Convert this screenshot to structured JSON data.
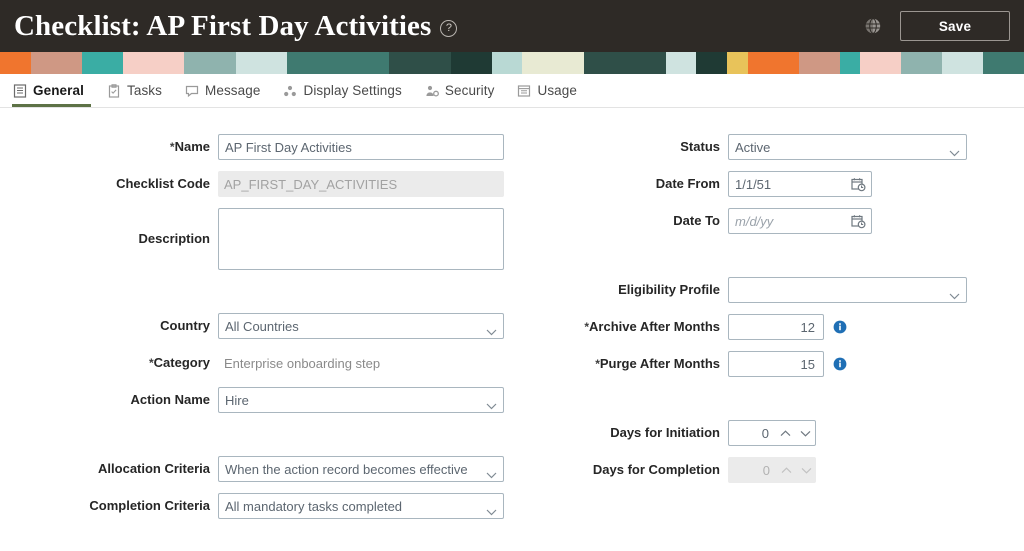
{
  "header": {
    "title": "Checklist: AP First Day Activities",
    "help_icon": "help-circle-icon",
    "globe_icon": "globe-icon",
    "save_label": "Save",
    "background_color": "#2e2a26"
  },
  "tabs": [
    {
      "label": "General",
      "icon": "list-lines-icon",
      "active": true
    },
    {
      "label": "Tasks",
      "icon": "clipboard-icon",
      "active": false
    },
    {
      "label": "Message",
      "icon": "speech-bubble-icon",
      "active": false
    },
    {
      "label": "Display Settings",
      "icon": "dots-group-icon",
      "active": false
    },
    {
      "label": "Security",
      "icon": "person-gear-icon",
      "active": false
    },
    {
      "label": "Usage",
      "icon": "window-list-icon",
      "active": false
    }
  ],
  "active_tab_color": "#5d7246",
  "form": {
    "left": {
      "name": {
        "label": "Name",
        "required": true,
        "value": "AP First Day Activities"
      },
      "checklist_code": {
        "label": "Checklist Code",
        "required": false,
        "value": "AP_FIRST_DAY_ACTIVITIES"
      },
      "description": {
        "label": "Description",
        "required": false,
        "value": ""
      },
      "country": {
        "label": "Country",
        "required": false,
        "value": "All Countries"
      },
      "category": {
        "label": "Category",
        "required": true,
        "value": "Enterprise onboarding step"
      },
      "action_name": {
        "label": "Action Name",
        "required": false,
        "value": "Hire"
      },
      "allocation_criteria": {
        "label": "Allocation Criteria",
        "required": false,
        "value": "When the action record becomes effective"
      },
      "completion_criteria": {
        "label": "Completion Criteria",
        "required": false,
        "value": "All mandatory tasks completed"
      }
    },
    "right": {
      "status": {
        "label": "Status",
        "required": false,
        "value": "Active"
      },
      "date_from": {
        "label": "Date From",
        "required": false,
        "value": "1/1/51",
        "placeholder": "m/d/yy"
      },
      "date_to": {
        "label": "Date To",
        "required": false,
        "value": "",
        "placeholder": "m/d/yy"
      },
      "eligibility_profile": {
        "label": "Eligibility Profile",
        "required": false,
        "value": ""
      },
      "archive_after_months": {
        "label": "Archive After Months",
        "required": true,
        "value": "12",
        "info_icon": "info-circle-icon"
      },
      "purge_after_months": {
        "label": "Purge After Months",
        "required": true,
        "value": "15",
        "info_icon": "info-circle-icon"
      },
      "days_for_initiation": {
        "label": "Days for Initiation",
        "required": false,
        "value": "0",
        "disabled": false
      },
      "days_for_completion": {
        "label": "Days for Completion",
        "required": false,
        "value": "0",
        "disabled": true
      }
    }
  },
  "banner_colors": [
    "#f0752e",
    "#cf9884",
    "#f6cfc6",
    "#3aada4",
    "#b9d9d4",
    "#8fb3ae",
    "#cfe3e0",
    "#3f7a70",
    "#2f4f48",
    "#1f3a34",
    "#e8ead3",
    "#e8c35a",
    "#d9e6e2"
  ]
}
